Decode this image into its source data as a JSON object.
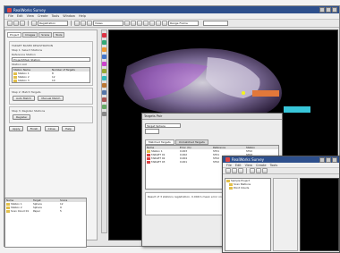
{
  "app": {
    "title": "RealWorks Survey",
    "menu": [
      "File",
      "Edit",
      "View",
      "Create",
      "Tools",
      "Window",
      "Help"
    ],
    "mode_select": "Registration",
    "view_select": "Views",
    "right_select": "Range Frame"
  },
  "left_panel": {
    "tabs": [
      "Project",
      "Images",
      "Scans",
      "Tools"
    ],
    "section_title": "TARGET BASED REGISTRATION",
    "step1": "Step 1: Select Stations",
    "reference_station_label": "Reference Station",
    "reference_station_value": "Project/Main Station",
    "station_list_label": "Station List",
    "list_headers": [
      "Station Name",
      "Number of Targets"
    ],
    "stations": [
      {
        "name": "Station 1",
        "count": "8"
      },
      {
        "name": "Station 2",
        "count": "12"
      },
      {
        "name": "Station 3",
        "count": "10"
      }
    ],
    "step2": "Step 2: Match Targets",
    "auto_match_label": "Auto Match",
    "manual_match_label": "Manual Match",
    "step3": "Step 3: Register Stations",
    "register_label": "Register",
    "buttons": [
      "Apply",
      "Finish",
      "Close",
      "Help"
    ]
  },
  "bottom_list": {
    "headers": [
      "Name",
      "Target",
      "Scans"
    ],
    "rows": [
      {
        "name": "Station 1",
        "target": "Sphere",
        "scans": "12"
      },
      {
        "name": "Station 2",
        "target": "Sphere",
        "scans": "9"
      },
      {
        "name": "Scan Cloud 01",
        "target": "Paper",
        "scans": "5"
      }
    ]
  },
  "dialog": {
    "title": "Targets Pair",
    "target_type_label": "Target Sphere",
    "tabs": [
      "Matched Targets",
      "Unmatched Targets"
    ],
    "headers": [
      "Name",
      "Error (m)",
      "Reference",
      "Station"
    ],
    "rows": [
      {
        "name": "Station 1",
        "error": "0.003",
        "ref": "ST01",
        "station": "ST02"
      },
      {
        "name": "TARGET 01",
        "error": "0.002",
        "ref": "ST01",
        "station": "ST03"
      },
      {
        "name": "TARGET 02",
        "error": "0.004",
        "ref": "ST02",
        "station": "ST03"
      },
      {
        "name": "TARGET 03",
        "error": "0.001",
        "ref": "ST02",
        "station": "ST04"
      }
    ],
    "note": "Result of 3 stations registration. 0.004m mean error on targets. 2 pairs used."
  },
  "front_window": {
    "title": "RealWorks Survey",
    "menu": [
      "File",
      "Edit",
      "View",
      "Create",
      "Tools"
    ],
    "tree": [
      "Sample Project",
      "Scan Stations",
      "Point Clouds"
    ]
  },
  "colors": {
    "title_bar": "#2d4f8c",
    "viewport_bg": "#000000",
    "cloud_purple": "#b04fd8",
    "label_cyan": "#38c6d9",
    "label_orange": "#e2783a"
  }
}
